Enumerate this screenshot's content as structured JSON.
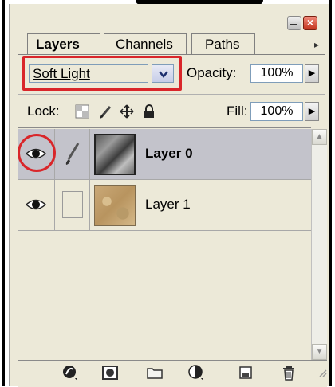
{
  "tabs": [
    {
      "label": "Layers",
      "active": true
    },
    {
      "label": "Channels",
      "active": false
    },
    {
      "label": "Paths",
      "active": false
    }
  ],
  "blend": {
    "mode": "Soft Light"
  },
  "opacity": {
    "label": "Opacity:",
    "value": "100%"
  },
  "lock": {
    "label": "Lock:"
  },
  "fill": {
    "label": "Fill:",
    "value": "100%"
  },
  "layers": [
    {
      "name": "Layer 0",
      "selected": true,
      "visible": true
    },
    {
      "name": "Layer 1",
      "selected": false,
      "visible": true
    }
  ],
  "icons": {
    "toolbar": [
      "link-layers-icon",
      "layer-style-icon",
      "layer-mask-icon",
      "new-group-icon",
      "adjustment-layer-icon",
      "new-layer-icon",
      "delete-layer-icon"
    ],
    "lock": [
      "lock-transparent-icon",
      "lock-image-icon",
      "lock-position-icon",
      "lock-all-icon"
    ]
  },
  "colors": {
    "highlight": "#d9262a",
    "selected_row": "#c3c3cb",
    "panel": "#ece9d8"
  }
}
